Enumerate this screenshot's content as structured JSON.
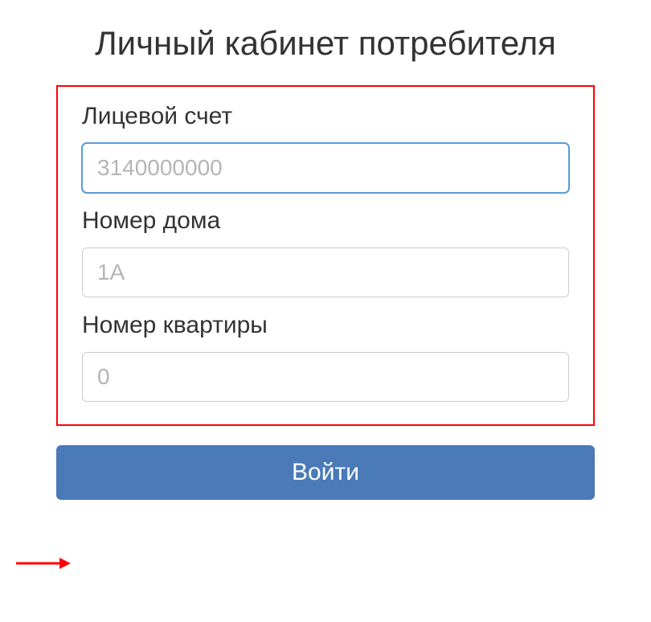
{
  "header": {
    "title": "Личный кабинет потребителя"
  },
  "form": {
    "account": {
      "label": "Лицевой счет",
      "placeholder": "3140000000",
      "value": ""
    },
    "house": {
      "label": "Номер дома",
      "placeholder": "1А",
      "value": ""
    },
    "apartment": {
      "label": "Номер квартиры",
      "placeholder": "0",
      "value": ""
    }
  },
  "actions": {
    "submit_label": "Войти"
  },
  "colors": {
    "highlight_box": "#ff0000",
    "primary_button": "#4a7ab8",
    "input_focus": "#5b9bd5"
  }
}
